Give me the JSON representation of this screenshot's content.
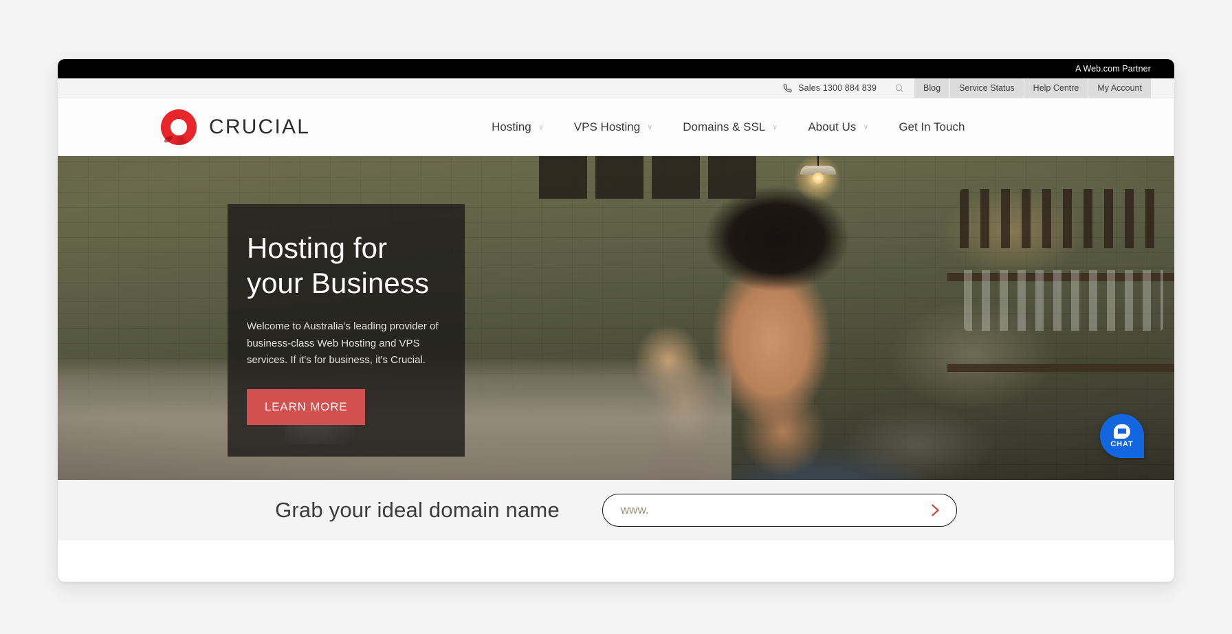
{
  "partner_bar": {
    "text": "A Web.com Partner"
  },
  "utility_bar": {
    "phone_icon": "phone-icon",
    "sales_label": "Sales 1300 884 839",
    "search_icon": "search-icon",
    "links": [
      {
        "label": "Blog"
      },
      {
        "label": "Service Status"
      },
      {
        "label": "Help Centre"
      },
      {
        "label": "My Account"
      }
    ]
  },
  "header": {
    "logo_mark": "crucial-ring-logo",
    "logo_text": "CRUCIAL",
    "nav": [
      {
        "label": "Hosting",
        "caret": "∨",
        "has_dropdown": true
      },
      {
        "label": "VPS Hosting",
        "caret": "∨",
        "has_dropdown": true
      },
      {
        "label": "Domains & SSL",
        "caret": "∨",
        "has_dropdown": true
      },
      {
        "label": "About Us",
        "caret": "∨",
        "has_dropdown": true
      },
      {
        "label": "Get In Touch",
        "caret": "",
        "has_dropdown": false
      }
    ]
  },
  "hero": {
    "title_line1": "Hosting for",
    "title_line2": "your Business",
    "subtitle": "Welcome to Australia's leading provider of business-class Web Hosting and VPS services. If it's for business, it's Crucial.",
    "cta_label": "LEARN MORE",
    "cta_color": "#d2504f",
    "panel_background": "rgba(28,26,25,0.80)"
  },
  "chat_widget": {
    "icon": "chat-bubble-icon",
    "label": "CHAT",
    "color": "#1266e0"
  },
  "domain_search": {
    "headline": "Grab your ideal domain name",
    "input_value": "",
    "input_placeholder": "www.",
    "submit_icon": "chevron-right-icon",
    "submit_color": "#d4463c"
  }
}
